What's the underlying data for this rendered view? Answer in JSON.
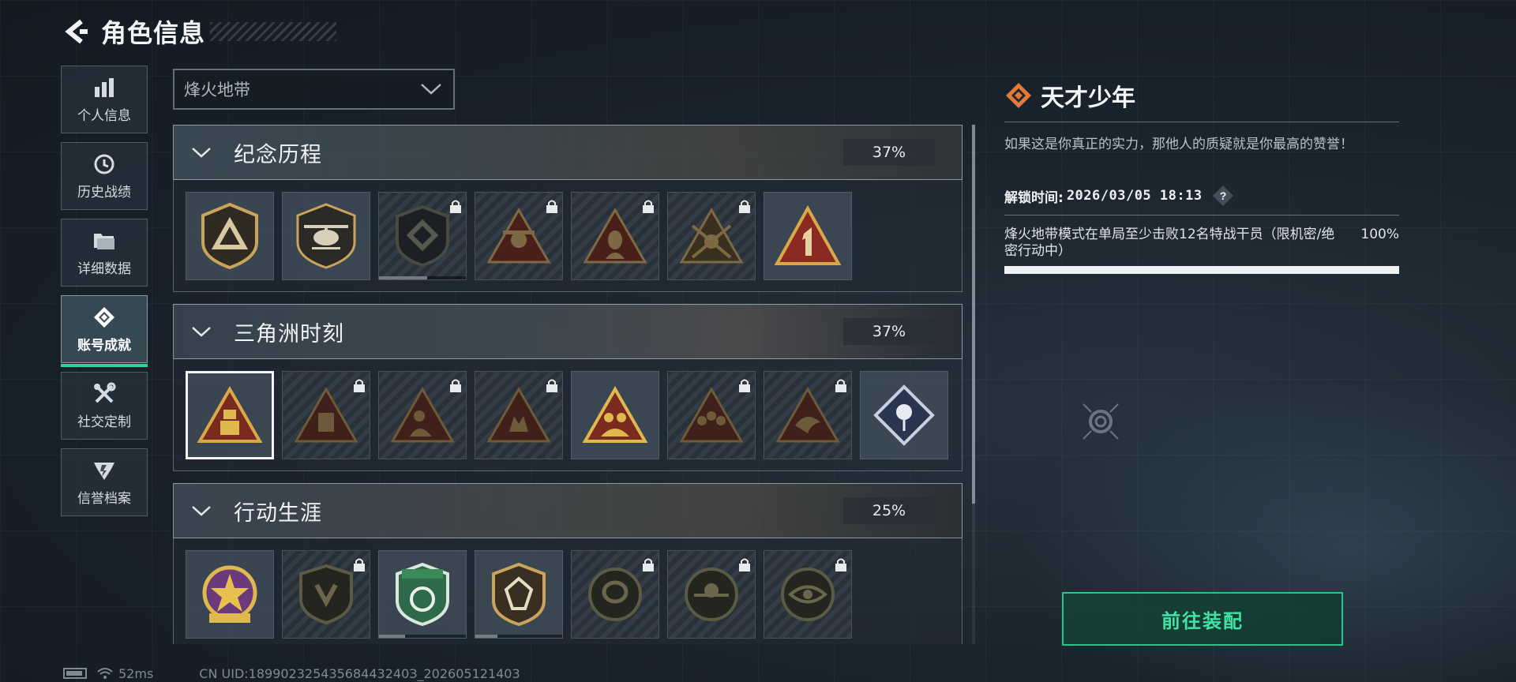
{
  "header": {
    "title": "角色信息"
  },
  "sidebar": {
    "items": [
      {
        "label": "个人信息",
        "icon": "bar-chart-icon"
      },
      {
        "label": "历史战绩",
        "icon": "clock-icon"
      },
      {
        "label": "详细数据",
        "icon": "folder-icon"
      },
      {
        "label": "账号成就",
        "icon": "achievement-icon",
        "active": true
      },
      {
        "label": "社交定制",
        "icon": "tools-icon"
      },
      {
        "label": "信誉档案",
        "icon": "emblem-icon"
      }
    ]
  },
  "mode_select": {
    "value": "烽火地带"
  },
  "sections": [
    {
      "name": "纪念历程",
      "percent": "37%",
      "badges": [
        {
          "icon": "triangle-shield-badge-icon",
          "locked": false
        },
        {
          "icon": "helicopter-badge-icon",
          "locked": false
        },
        {
          "icon": "diamond-shield-badge-icon",
          "locked": true,
          "progress": 0.55
        },
        {
          "icon": "skull-triangle-badge-icon",
          "locked": true
        },
        {
          "icon": "woman-triangle-badge-icon",
          "locked": true
        },
        {
          "icon": "crossed-guns-badge-icon",
          "locked": true
        },
        {
          "icon": "number-one-triangle-badge-icon",
          "locked": false
        }
      ]
    },
    {
      "name": "三角洲时刻",
      "percent": "37%",
      "badges": [
        {
          "icon": "robot-triangle-badge-icon",
          "locked": false,
          "selected": true
        },
        {
          "icon": "mask-triangle-badge-icon",
          "locked": true
        },
        {
          "icon": "soldier-triangle-badge-icon",
          "locked": true
        },
        {
          "icon": "hands-triangle-badge-icon",
          "locked": true
        },
        {
          "icon": "team-triangle-badge-icon",
          "locked": false
        },
        {
          "icon": "squad-triangle-badge-icon",
          "locked": true
        },
        {
          "icon": "bird-triangle-badge-icon",
          "locked": true
        },
        {
          "icon": "rose-diamond-badge-icon",
          "locked": false
        }
      ]
    },
    {
      "name": "行动生涯",
      "percent": "25%",
      "badges": [
        {
          "icon": "star-round-badge-icon",
          "locked": false
        },
        {
          "icon": "crest-badge-icon",
          "locked": true
        },
        {
          "icon": "green-shield-badge-icon",
          "locked": false,
          "progress": 0.3
        },
        {
          "icon": "gem-shield-badge-icon",
          "locked": false,
          "progress": 0.25
        },
        {
          "icon": "hand-circle-badge-icon",
          "locked": true
        },
        {
          "icon": "skull-circle-badge-icon",
          "locked": true
        },
        {
          "icon": "eye-circle-badge-icon",
          "locked": true
        }
      ]
    }
  ],
  "detail": {
    "title": "天才少年",
    "description": "如果这是你真正的实力，那他人的质疑就是你最高的赞誉！",
    "unlock_label": "解锁时间:",
    "unlock_time": "2026/03/05 18:13",
    "help_symbol": "?",
    "task_text": "烽火地带模式在单局至少击败12名特战干员（限机密/绝密行动中）",
    "task_percent": "100%",
    "task_progress": 1.0
  },
  "equip_button": {
    "label": "前往装配"
  },
  "status_bar": {
    "ping": "52ms",
    "uid": "CN UID:18990232543568443240З_202605121403"
  },
  "colors": {
    "accent": "#25c688",
    "active_underline": "#2fd49a",
    "title_icon": "#e2793a",
    "badge_gold": "#c9a45a",
    "badge_red": "#8a2a22"
  }
}
